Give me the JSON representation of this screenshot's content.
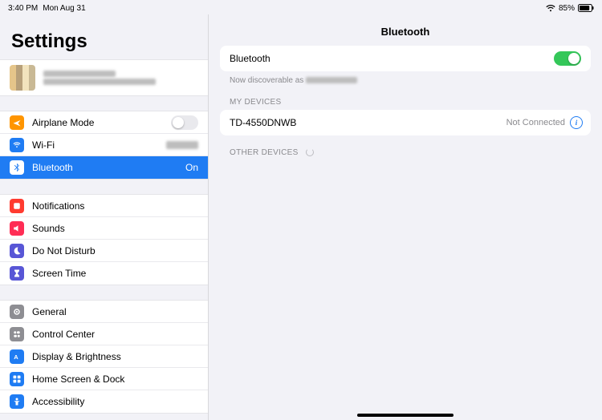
{
  "statusbar": {
    "time": "3:40 PM",
    "date": "Mon Aug 31",
    "battery_pct": "85%"
  },
  "sidebar": {
    "title": "Settings",
    "rows": {
      "airplane": "Airplane Mode",
      "wifi": "Wi-Fi",
      "bluetooth": "Bluetooth",
      "bluetooth_value": "On",
      "notifications": "Notifications",
      "sounds": "Sounds",
      "dnd": "Do Not Disturb",
      "screentime": "Screen Time",
      "general": "General",
      "controlcenter": "Control Center",
      "display": "Display & Brightness",
      "home": "Home Screen & Dock",
      "accessibility": "Accessibility"
    }
  },
  "detail": {
    "title": "Bluetooth",
    "toggle_label": "Bluetooth",
    "discoverable_prefix": "Now discoverable as",
    "my_devices_header": "MY DEVICES",
    "other_devices_header": "OTHER DEVICES",
    "device": {
      "name": "TD-4550DNWB",
      "status": "Not Connected"
    }
  }
}
